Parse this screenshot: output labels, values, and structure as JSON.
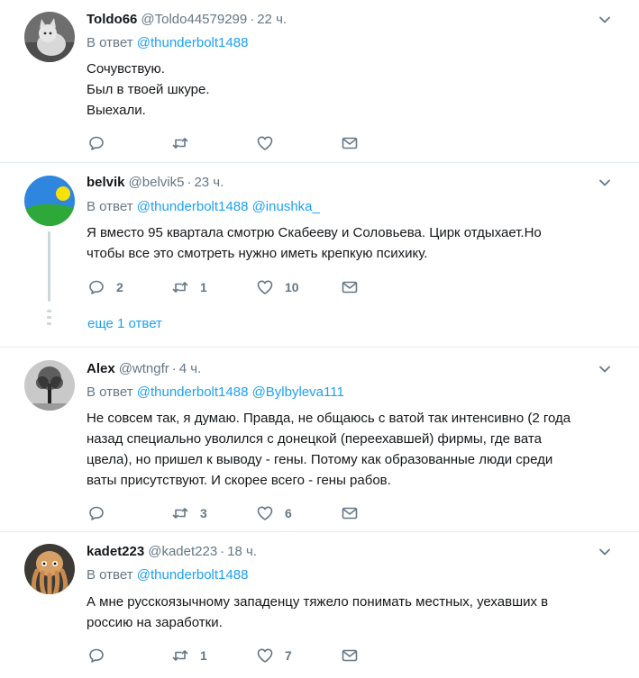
{
  "colors": {
    "accent": "#1da1f2",
    "muted": "#657786",
    "text": "#14171a",
    "border": "#e6ecf0"
  },
  "tweets": [
    {
      "name": "Toldo66",
      "handle": "@Toldo44579299",
      "time": "22 ч.",
      "reply_prefix": "В ответ",
      "mentions": [
        "@thunderbolt1488"
      ],
      "text_lines": [
        "Сочувствую.",
        "Был в твоей шкуре.",
        "Выехали."
      ],
      "replies": "",
      "retweets": "",
      "likes": ""
    },
    {
      "name": "belvik",
      "handle": "@belvik5",
      "time": "23 ч.",
      "reply_prefix": "В ответ",
      "mentions": [
        "@thunderbolt1488",
        "@inushka_"
      ],
      "text_lines": [
        "Я вместо 95 квартала смотрю Скабееву и Соловьева. Цирк отдыхает.Но",
        "чтобы все это смотреть нужно иметь крепкую психику."
      ],
      "replies": "2",
      "retweets": "1",
      "likes": "10",
      "more_replies": "еще 1 ответ"
    },
    {
      "name": "Alex",
      "handle": "@wtngfr",
      "time": "4 ч.",
      "reply_prefix": "В ответ",
      "mentions": [
        "@thunderbolt1488",
        "@Bylbyleva111"
      ],
      "text_lines": [
        "Не совсем так, я думаю. Правда, не общаюсь с ватой так интенсивно (2 года",
        "назад специально уволился с донецкой (переехавшей) фирмы, где вата",
        "цвела), но пришел к выводу - гены. Потому как образованные люди среди",
        "ваты присутствуют. И скорее всего - гены рабов."
      ],
      "replies": "",
      "retweets": "3",
      "likes": "6"
    },
    {
      "name": "kadet223",
      "handle": "@kadet223",
      "time": "18 ч.",
      "reply_prefix": "В ответ",
      "mentions": [
        "@thunderbolt1488"
      ],
      "text_lines": [
        "А мне русскоязычному западенцу тяжело понимать местных, уехавших в",
        "россию на заработки."
      ],
      "replies": "",
      "retweets": "1",
      "likes": "7"
    }
  ]
}
